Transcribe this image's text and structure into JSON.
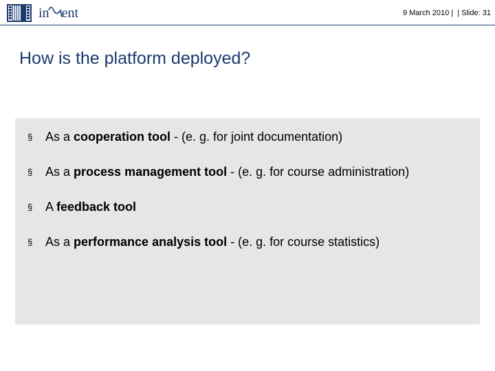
{
  "header": {
    "date": "9 March 2010",
    "slide_label": "Slide:",
    "slide_no": "31",
    "logo_text_pre": "in",
    "logo_text_post": "ent"
  },
  "title": "How is the platform deployed?",
  "bullets": [
    {
      "pre": "As a ",
      "bold": "cooperation tool",
      "post": " - (e. g. for joint documentation)"
    },
    {
      "pre": "As a ",
      "bold": "process management tool",
      "post": " - (e. g. for course administration)"
    },
    {
      "pre": "A ",
      "bold": "feedback tool",
      "post": ""
    },
    {
      "pre": "As a ",
      "bold": "performance analysis tool",
      "post": " - (e. g. for course statistics)"
    }
  ]
}
